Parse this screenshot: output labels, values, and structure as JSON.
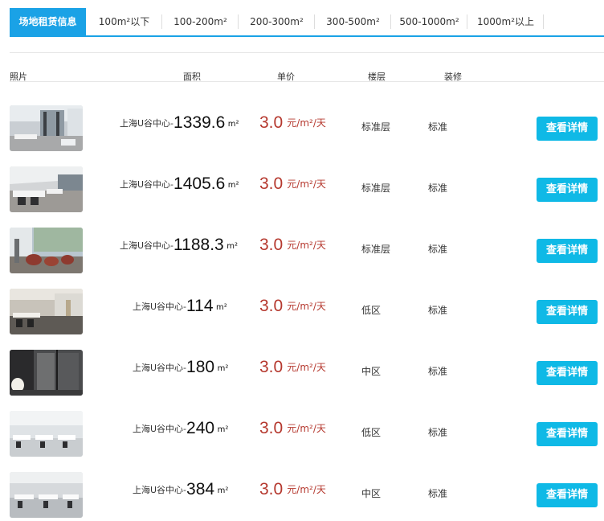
{
  "tabs": [
    {
      "label": "场地租赁信息",
      "active": true
    },
    {
      "label": "100m²以下",
      "active": false
    },
    {
      "label": "100-200m²",
      "active": false
    },
    {
      "label": "200-300m²",
      "active": false
    },
    {
      "label": "300-500m²",
      "active": false
    },
    {
      "label": "500-1000m²",
      "active": false
    },
    {
      "label": "1000m²以上",
      "active": false
    }
  ],
  "columns": {
    "photo": "照片",
    "area": "面积",
    "price": "单价",
    "floor": "楼层",
    "decor": "装修"
  },
  "listings": [
    {
      "building": "上海U谷中心-",
      "area": "1339.6",
      "area_unit": "m²",
      "price": "3.0",
      "price_unit": "元/m²/天",
      "floor": "标准层",
      "decor": "标准",
      "button": "查看详情"
    },
    {
      "building": "上海U谷中心-",
      "area": "1405.6",
      "area_unit": "m²",
      "price": "3.0",
      "price_unit": "元/m²/天",
      "floor": "标准层",
      "decor": "标准",
      "button": "查看详情"
    },
    {
      "building": "上海U谷中心-",
      "area": "1188.3",
      "area_unit": "m²",
      "price": "3.0",
      "price_unit": "元/m²/天",
      "floor": "标准层",
      "decor": "标准",
      "button": "查看详情"
    },
    {
      "building": "上海U谷中心-",
      "area": "114",
      "area_unit": "m²",
      "price": "3.0",
      "price_unit": "元/m²/天",
      "floor": "低区",
      "decor": "标准",
      "button": "查看详情"
    },
    {
      "building": "上海U谷中心-",
      "area": "180",
      "area_unit": "m²",
      "price": "3.0",
      "price_unit": "元/m²/天",
      "floor": "中区",
      "decor": "标准",
      "button": "查看详情"
    },
    {
      "building": "上海U谷中心-",
      "area": "240",
      "area_unit": "m²",
      "price": "3.0",
      "price_unit": "元/m²/天",
      "floor": "低区",
      "decor": "标准",
      "button": "查看详情"
    },
    {
      "building": "上海U谷中心-",
      "area": "384",
      "area_unit": "m²",
      "price": "3.0",
      "price_unit": "元/m²/天",
      "floor": "中区",
      "decor": "标准",
      "button": "查看详情"
    }
  ],
  "colors": {
    "accent": "#1aa2e6",
    "button": "#0fb9e6",
    "price": "#b5382e"
  }
}
